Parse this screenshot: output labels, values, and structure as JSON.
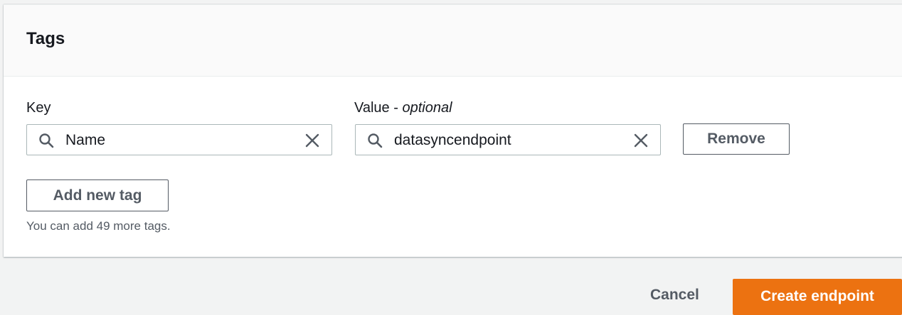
{
  "section": {
    "title": "Tags"
  },
  "tag_row": {
    "key_label": "Key",
    "value_label_main": "Value - ",
    "value_label_optional": "optional",
    "key_value": "Name",
    "value_value": "datasyncendpoint",
    "remove_label": "Remove"
  },
  "add_tag_label": "Add new tag",
  "hint_text": "You can add 49 more tags.",
  "footer": {
    "cancel_label": "Cancel",
    "create_label": "Create endpoint"
  },
  "colors": {
    "primary": "#ec7211",
    "border": "#aab7b8",
    "secondary_text": "#545b64"
  },
  "icons": {
    "search": "search-icon",
    "clear": "close-icon"
  }
}
